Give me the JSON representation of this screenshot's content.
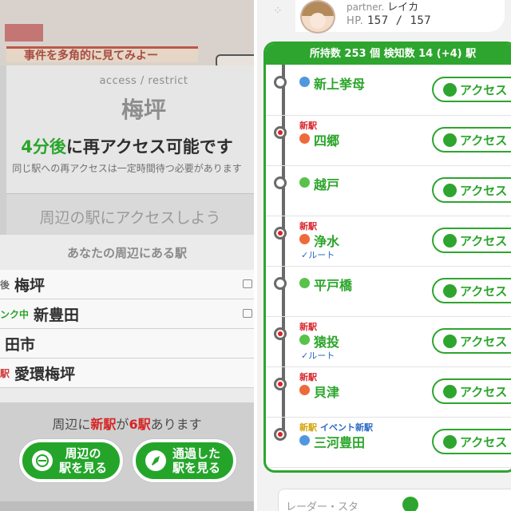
{
  "left": {
    "background_title": "事件を多角的に見てみよー",
    "access_label": "access / restrict",
    "station_name": "梅坪",
    "reaccess_green": "4分後",
    "reaccess_rest": "に再アクセス可能です",
    "note": "同じ駅への再アクセスは一定時間待つ必要があります",
    "access_nearby": "周辺の駅にアクセスしよう",
    "nearby_title": "あなたの周辺にある駅",
    "nearby_list": [
      {
        "tag": "後",
        "name": "梅坪"
      },
      {
        "tag": "ンク中",
        "name": "新豊田"
      },
      {
        "tag": "",
        "name": "田市"
      },
      {
        "tag": "駅",
        "name": "愛環梅坪"
      }
    ],
    "new_count_prefix": "周辺に",
    "new_count_word": "新駅",
    "new_count_mid": "が",
    "new_count_num": "6駅",
    "new_count_suffix": "あります",
    "btn_nearby": "周辺の\n駅を見る",
    "btn_passed": "通過した\n駅を見る"
  },
  "right": {
    "partner_label": "partner.",
    "partner_name": "レイカ",
    "hp_label": "HP.",
    "hp_value": "157 / 157",
    "list_header": "所持数 253 個 検知数 14 (+4) 駅",
    "stations": [
      {
        "name": "新上挙母",
        "new": false,
        "event": false,
        "route": false,
        "color": "#4f98e0"
      },
      {
        "name": "四郷",
        "new": true,
        "event": false,
        "route": false,
        "color": "#ef6a3a"
      },
      {
        "name": "越戸",
        "new": false,
        "event": false,
        "route": false,
        "color": "#58c24a"
      },
      {
        "name": "浄水",
        "new": true,
        "event": false,
        "route": true,
        "color": "#ef6a3a"
      },
      {
        "name": "平戸橋",
        "new": false,
        "event": false,
        "route": false,
        "color": "#58c24a"
      },
      {
        "name": "猿投",
        "new": true,
        "event": false,
        "route": true,
        "color": "#58c24a"
      },
      {
        "name": "貝津",
        "new": true,
        "event": false,
        "route": false,
        "color": "#ef6a3a"
      },
      {
        "name": "三河豊田",
        "new": true,
        "event": true,
        "route": false,
        "color": "#4f98e0"
      }
    ],
    "new_tag": "新駅",
    "event_tag": "イベント新駅",
    "route_label": "ルート",
    "access_button": "アクセス",
    "next_section": "レーダー・スタ"
  }
}
